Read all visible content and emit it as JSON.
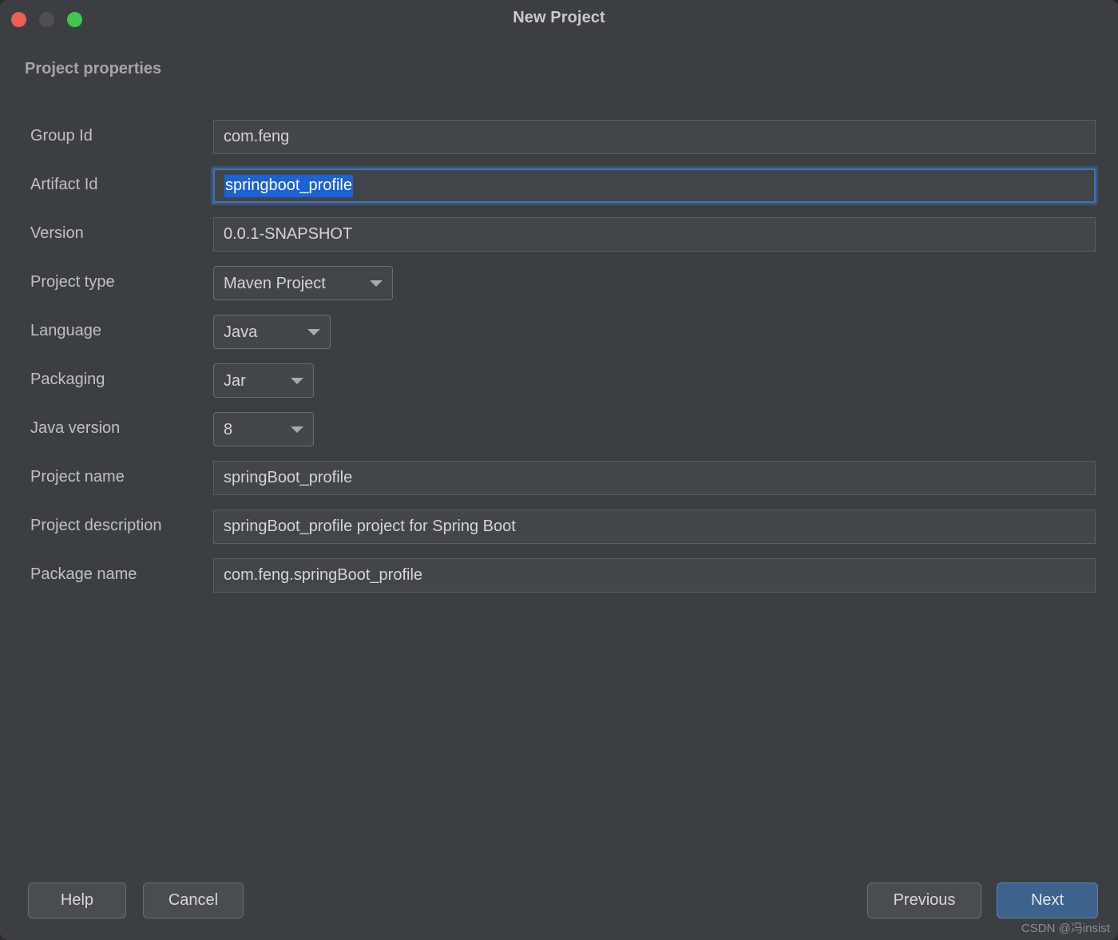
{
  "window": {
    "title": "New Project",
    "traffic_lights": [
      {
        "name": "close-button",
        "color": "#ee5f56"
      },
      {
        "name": "minimize-button",
        "color": "#4e5052"
      },
      {
        "name": "zoom-button",
        "color": "#41c84a"
      }
    ]
  },
  "section": {
    "heading": "Project properties"
  },
  "fields": {
    "group_id": {
      "label": "Group Id",
      "value": "com.feng"
    },
    "artifact_id": {
      "label": "Artifact Id",
      "value": "springboot_profile"
    },
    "version": {
      "label": "Version",
      "value": "0.0.1-SNAPSHOT"
    },
    "project_type": {
      "label": "Project type",
      "value": "Maven Project"
    },
    "language": {
      "label": "Language",
      "value": "Java"
    },
    "packaging": {
      "label": "Packaging",
      "value": "Jar"
    },
    "java_version": {
      "label": "Java version",
      "value": "8"
    },
    "project_name": {
      "label": "Project name",
      "value": "springBoot_profile"
    },
    "project_description": {
      "label": "Project description",
      "value": "springBoot_profile project for Spring Boot"
    },
    "package_name": {
      "label": "Package name",
      "value": "com.feng.springBoot_profile"
    }
  },
  "footer": {
    "help_label": "Help",
    "cancel_label": "Cancel",
    "previous_label": "Previous",
    "next_label": "Next"
  },
  "watermark": {
    "text": "CSDN @冯insist"
  },
  "colors": {
    "window_background": "#3c3f41",
    "field_background": "#434649",
    "field_border": "#5c5f61",
    "focus_border": "#3e72b8",
    "selection_highlight": "#1a63d6",
    "primary_button": "#3d628c",
    "text": "#d3d5d7",
    "label_text": "#bfc1c3"
  }
}
